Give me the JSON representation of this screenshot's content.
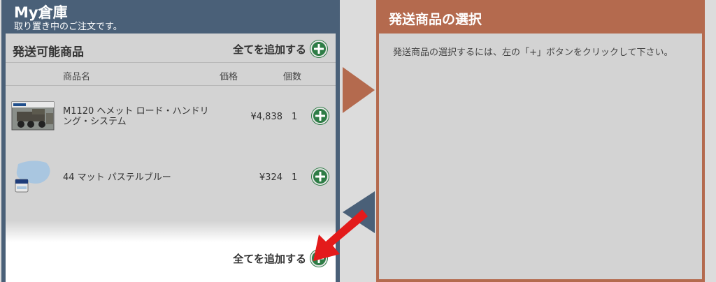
{
  "header": {
    "title": "My倉庫",
    "subtitle": "取り置き中のご注文です。"
  },
  "available": {
    "section_title": "発送可能商品",
    "add_all_label": "全てを追加する",
    "columns": {
      "name": "商品名",
      "price": "価格",
      "qty": "個数"
    },
    "items": [
      {
        "name": "M1120 ヘメット ロード・ハンドリング・システム",
        "price": "¥4,838",
        "qty": "1",
        "thumb": "truck-kit-box"
      },
      {
        "name": "44 マット パステルブルー",
        "price": "¥324",
        "qty": "1",
        "thumb": "paint-tin"
      }
    ],
    "add_all_bottom_label": "全てを追加する"
  },
  "shipping": {
    "title": "発送商品の選択",
    "instructions": "発送商品の選択するには、左の「+」ボタンをクリックして下さい。"
  },
  "colors": {
    "left_accent": "#4a6078",
    "right_accent": "#b46a4e",
    "plus_green": "#2e7d46",
    "pointer_red": "#e31b1b"
  }
}
